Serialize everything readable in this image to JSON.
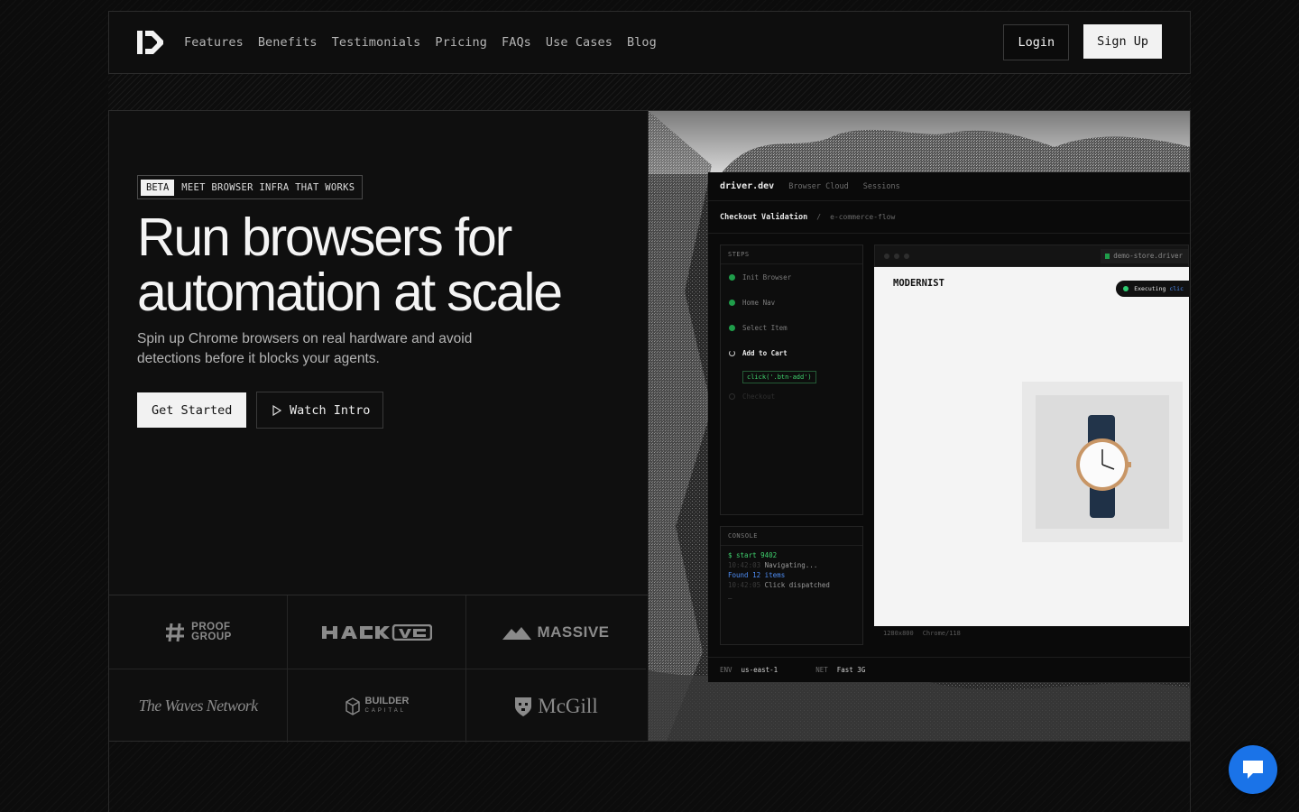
{
  "nav": {
    "links": [
      "Features",
      "Benefits",
      "Testimonials",
      "Pricing",
      "FAQs",
      "Use Cases",
      "Blog"
    ],
    "login_label": "Login",
    "signup_label": "Sign Up"
  },
  "hero": {
    "badge_tag": "BETA",
    "badge_text": "MEET BROWSER INFRA THAT WORKS",
    "headline_line1": "Run browsers for",
    "headline_line2": "automation at scale",
    "subtitle": "Spin up Chrome browsers on real hardware and avoid detections before it blocks your agents.",
    "cta_primary": "Get Started",
    "cta_secondary": "Watch Intro"
  },
  "logos": [
    {
      "name": "PROOF GROUP",
      "line1": "PROOF",
      "line2": "GROUP"
    },
    {
      "name": "HACK VC"
    },
    {
      "name": "MASSIVE"
    },
    {
      "name": "The Waves Network"
    },
    {
      "name": "BUILDER CAPITAL",
      "line1": "BUILDER",
      "line2": "CAPITAL"
    },
    {
      "name": "McGill"
    }
  ],
  "app_mock": {
    "brand": "driver.dev",
    "tabs": [
      "Browser Cloud",
      "Sessions"
    ],
    "breadcrumb_current": "Checkout Validation",
    "breadcrumb_sep": "/",
    "breadcrumb_flow": "e-commerce-flow",
    "steps_header": "STEPS",
    "steps": [
      "Init Browser",
      "Home Nav",
      "Select Item",
      "Add to Cart",
      "Checkout"
    ],
    "active_step_code": "click('.btn-add')",
    "console_header": "CONSOLE",
    "console_lines": [
      {
        "time": "$",
        "text": "start 9402"
      },
      {
        "time": "10:42:03",
        "text": "Navigating..."
      },
      {
        "time": "",
        "text": "Found 12 items"
      },
      {
        "time": "10:42:05",
        "text": "Click dispatched"
      },
      {
        "time": "",
        "text": "_"
      }
    ],
    "url": "demo-store.driver",
    "store_name": "MODERNIST",
    "executing": "Executing",
    "executing_code": "clic",
    "viewport": "1280x800",
    "browser": "Chrome/118",
    "env_label": "ENV",
    "env_value": "us-east-1",
    "net_label": "NET",
    "net_value": "Fast 3G"
  }
}
